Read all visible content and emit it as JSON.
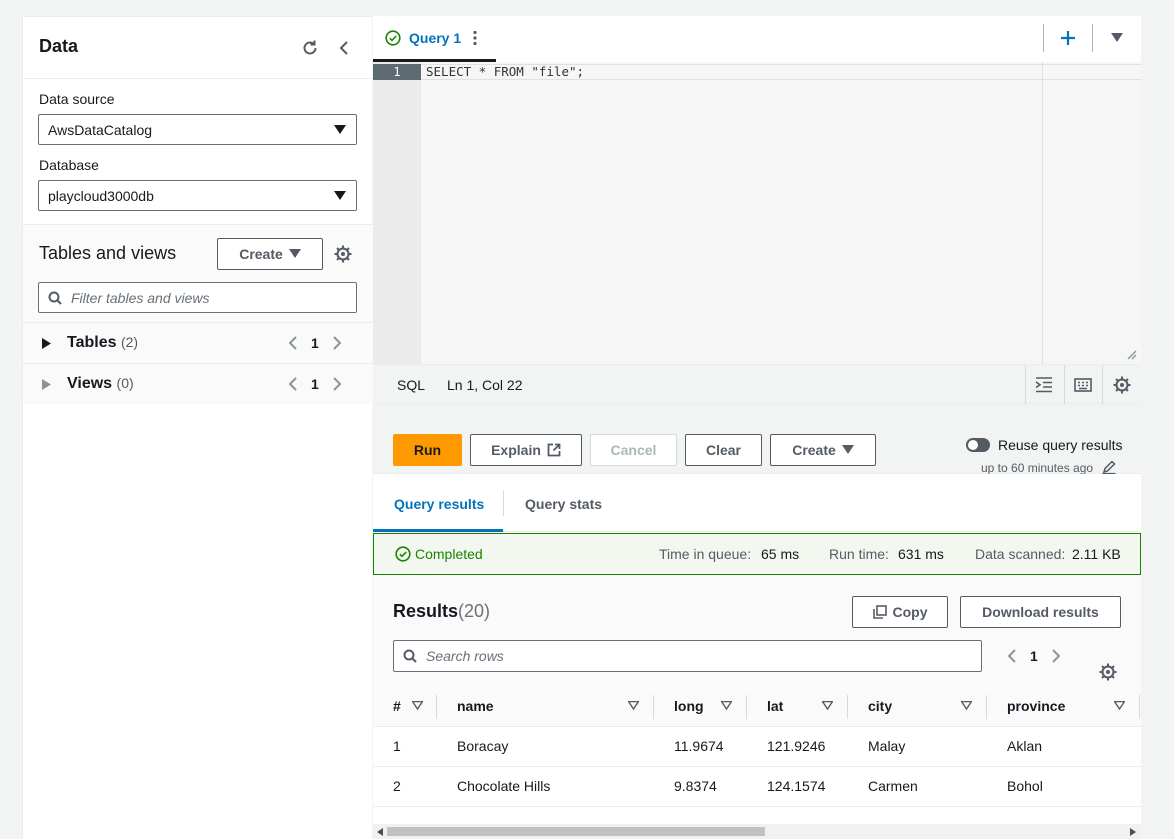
{
  "left_panel": {
    "title": "Data",
    "data_source_label": "Data source",
    "data_source_value": "AwsDataCatalog",
    "database_label": "Database",
    "database_value": "playcloud3000db",
    "tables_and_views_title": "Tables and views",
    "create_label": "Create",
    "filter_placeholder": "Filter tables and views",
    "tables": {
      "label": "Tables",
      "count": "(2)",
      "page": "1"
    },
    "views": {
      "label": "Views",
      "count": "(0)",
      "page": "1"
    }
  },
  "editor": {
    "tab_label": "Query 1",
    "line_number": "1",
    "code": "SELECT * FROM \"file\";",
    "language": "SQL",
    "cursor_position": "Ln 1, Col 22"
  },
  "actions": {
    "run": "Run",
    "explain": "Explain",
    "cancel": "Cancel",
    "clear": "Clear",
    "create": "Create",
    "reuse_label": "Reuse query results",
    "reuse_sub": "up to 60 minutes ago"
  },
  "result_tabs": {
    "results": "Query results",
    "stats": "Query stats"
  },
  "status": {
    "text": "Completed",
    "queue_label": "Time in queue:",
    "queue_value": "65 ms",
    "run_label": "Run time:",
    "run_value": "631 ms",
    "scanned_label": "Data scanned:",
    "scanned_value": "2.11 KB"
  },
  "results": {
    "title": "Results",
    "count": "(20)",
    "copy": "Copy",
    "download": "Download results",
    "search_placeholder": "Search rows",
    "page": "1",
    "columns": [
      "#",
      "name",
      "long",
      "lat",
      "city",
      "province"
    ],
    "rows": [
      [
        "1",
        "Boracay",
        "11.9674",
        "121.9246",
        "Malay",
        "Aklan"
      ],
      [
        "2",
        "Chocolate Hills",
        "9.8374",
        "124.1574",
        "Carmen",
        "Bohol"
      ]
    ]
  },
  "colors": {
    "accent": "#0073bb",
    "primary_button": "#ff9900",
    "success": "#1d8102"
  }
}
